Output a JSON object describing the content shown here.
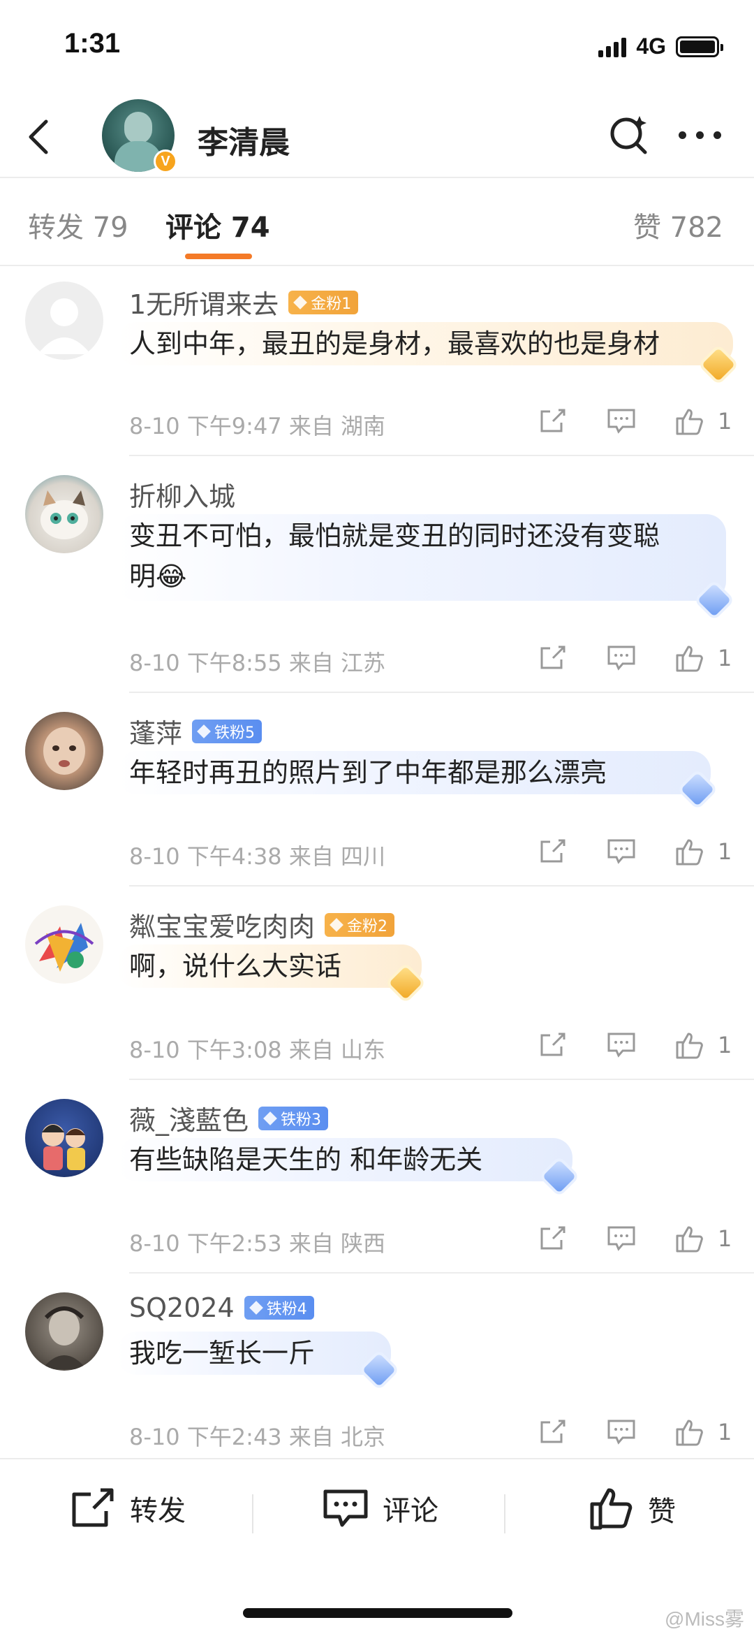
{
  "status_bar": {
    "time": "1:31",
    "network": "4G"
  },
  "header": {
    "title": "李清晨"
  },
  "tabs": {
    "repost": "转发 79",
    "comment": "评论 74",
    "like": "赞 782"
  },
  "comments": [
    {
      "username": "1无所谓来去",
      "badge": "金粉1",
      "badge_type": "gold",
      "text_lines": [
        "人到中年，最丑的是身材，最喜欢的也是身材"
      ],
      "meta": "8-10 下午9:47 来自 湖南",
      "likes": "1"
    },
    {
      "username": "折柳入城",
      "badge": "",
      "badge_type": "iron",
      "text_lines": [
        "变丑不可怕，最怕就是变丑的同时还没有变聪",
        "明😂"
      ],
      "meta": "8-10 下午8:55 来自 江苏",
      "likes": "1"
    },
    {
      "username": "蓬萍",
      "badge": "铁粉5",
      "badge_type": "iron",
      "text_lines": [
        "年轻时再丑的照片到了中年都是那么漂亮"
      ],
      "meta": "8-10 下午4:38 来自 四川",
      "likes": "1"
    },
    {
      "username": "粼宝宝爱吃肉肉",
      "badge": "金粉2",
      "badge_type": "gold",
      "text_lines": [
        "啊，说什么大实话"
      ],
      "meta": "8-10 下午3:08 来自 山东",
      "likes": "1"
    },
    {
      "username": "薇_淺藍色",
      "badge": "铁粉3",
      "badge_type": "iron",
      "text_lines": [
        "有些缺陷是天生的 和年龄无关"
      ],
      "meta": "8-10 下午2:53 来自 陕西",
      "likes": "1"
    },
    {
      "username": "SQ2024",
      "badge": "铁粉4",
      "badge_type": "iron",
      "text_lines": [
        "我吃一堑长一斤"
      ],
      "meta": "8-10 下午2:43 来自 北京",
      "likes": "1"
    }
  ],
  "bottom_bar": {
    "repost": "转发",
    "comment": "评论",
    "like": "赞"
  },
  "watermark": "@Miss雾"
}
